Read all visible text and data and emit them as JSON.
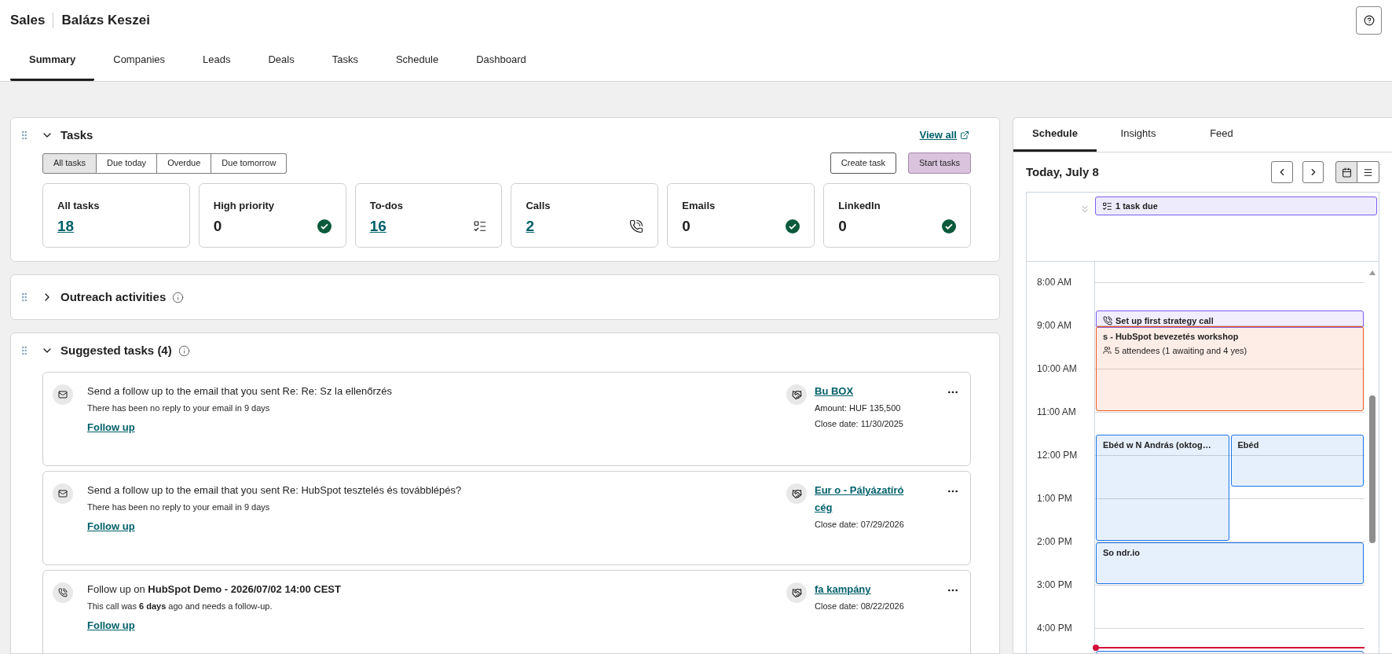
{
  "header": {
    "app": "Sales",
    "user": "Balázs Keszei"
  },
  "nav_tabs": [
    {
      "label": "Summary",
      "selected": true
    },
    {
      "label": "Companies",
      "selected": false
    },
    {
      "label": "Leads",
      "selected": false
    },
    {
      "label": "Deals",
      "selected": false
    },
    {
      "label": "Tasks",
      "selected": false
    },
    {
      "label": "Schedule",
      "selected": false
    },
    {
      "label": "Dashboard",
      "selected": false
    }
  ],
  "tasks_card": {
    "title": "Tasks",
    "expanded": true,
    "view_all": "View all",
    "filters": [
      {
        "label": "All tasks",
        "selected": true
      },
      {
        "label": "Due today",
        "selected": false
      },
      {
        "label": "Overdue",
        "selected": false
      },
      {
        "label": "Due tomorrow",
        "selected": false
      }
    ],
    "actions": [
      {
        "label": "Create task",
        "kind": "secondary"
      },
      {
        "label": "Start tasks",
        "kind": "primary"
      }
    ],
    "stats": [
      {
        "label": "All tasks",
        "value": "18",
        "kind": "link"
      },
      {
        "label": "High priority",
        "value": "0",
        "kind": "done"
      },
      {
        "label": "To-dos",
        "value": "16",
        "kind": "todo"
      },
      {
        "label": "Calls",
        "value": "2",
        "kind": "call"
      },
      {
        "label": "Emails",
        "value": "0",
        "kind": "done"
      },
      {
        "label": "LinkedIn",
        "value": "0",
        "kind": "done"
      }
    ]
  },
  "outreach_card": {
    "title": "Outreach activities",
    "expanded": false
  },
  "suggested_card": {
    "title": "Suggested tasks (4)",
    "expanded": true,
    "items": [
      {
        "kind": "email",
        "title": "Send a follow up to the email that you sent Re: Re: Sz la ellenőrzés",
        "subtitle": "There has been no reply to your email in 9 days",
        "action": "Follow up",
        "deal": {
          "name": "Bu BOX",
          "lines": [
            "Amount: HUF 135,500",
            "Close date: 11/30/2025"
          ]
        }
      },
      {
        "kind": "email",
        "title": "Send a follow up to the email that you sent Re: HubSpot tesztelés és továbblépés?",
        "subtitle": "There has been no reply to your email in 9 days",
        "action": "Follow up",
        "deal": {
          "name": "Eur o - Pályázatíró cég",
          "lines": [
            "Close date: 07/29/2026"
          ]
        }
      },
      {
        "kind": "call",
        "title": "Follow up on **HubSpot Demo - 2026/07/02 14:00 CEST**",
        "subtitle": "This call was **6 days** ago and needs a follow-up.",
        "action": "Follow up",
        "deal": {
          "name": "fa kampány",
          "lines": [
            "Close date: 08/22/2026"
          ]
        }
      }
    ]
  },
  "side_panel": {
    "tabs": [
      {
        "label": "Schedule",
        "selected": true
      },
      {
        "label": "Insights",
        "selected": false
      },
      {
        "label": "Feed",
        "selected": false
      }
    ],
    "date": "Today, July 8",
    "view_modes": [
      {
        "kind": "calendar",
        "selected": true
      },
      {
        "kind": "list",
        "selected": false
      }
    ],
    "all_day": [
      {
        "kind": "task",
        "title": "1 task due",
        "color": "#7c5cf0"
      }
    ],
    "hours": [
      "8:00 AM",
      "9:00 AM",
      "10:00 AM",
      "11:00 AM",
      "12:00 PM",
      "1:00 PM",
      "2:00 PM",
      "3:00 PM",
      "4:00 PM"
    ],
    "events": [
      {
        "kind": "call",
        "title": "Set up first strategy call",
        "color": "#7c5cf0"
      },
      {
        "kind": "meeting",
        "title": "s - HubSpot bevezetés workshop",
        "detail": "5 attendees (1 awaiting and 4 yes)",
        "color": "#ea5a1e"
      },
      {
        "kind": "meeting",
        "title": "Ebéd w N András (oktog…",
        "color": "#1a73e8"
      },
      {
        "kind": "meeting",
        "title": "Ebéd",
        "color": "#1a73e8"
      },
      {
        "kind": "meeting",
        "title": "So ndr.io",
        "color": "#1a73e8"
      },
      {
        "kind": "meeting",
        "color": "#1a73e8"
      }
    ]
  }
}
